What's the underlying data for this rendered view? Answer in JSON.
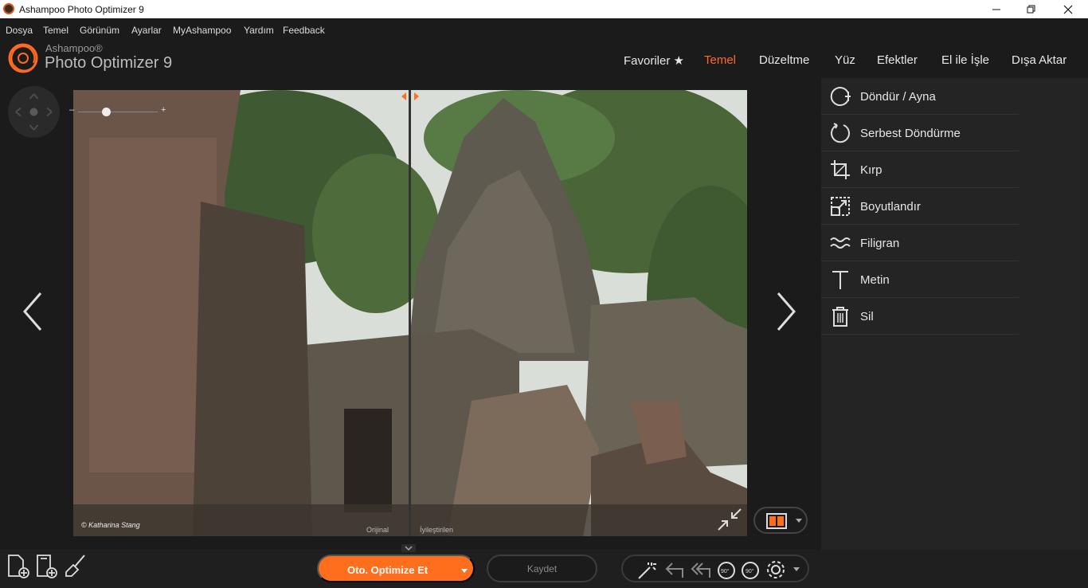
{
  "window": {
    "title": "Ashampoo Photo Optimizer 9"
  },
  "menu": [
    "Dosya",
    "Temel",
    "Görünüm",
    "Ayarlar",
    "MyAshampoo",
    "Yardım",
    "Feedback"
  ],
  "brand": {
    "small": "Ashampoo®",
    "big": "Photo Optimizer 9"
  },
  "nav": {
    "items": [
      "Favoriler ★",
      "Temel",
      "Düzeltme",
      "Yüz",
      "Efektler",
      "El ile İşle",
      "Dışa Aktar"
    ],
    "active": "Temel"
  },
  "viewer": {
    "credit": "© Katharina Stang",
    "label_left": "Orijinal",
    "label_right": "İyileştirilen"
  },
  "tools": [
    "Döndür / Ayna",
    "Serbest Döndürme",
    "Kırp",
    "Boyutlandır",
    "Filigran",
    "Metin",
    "Sil"
  ],
  "bottom": {
    "optimize": "Oto. Optimize Et",
    "save": "Kaydet"
  },
  "colors": {
    "accent": "#ff6e1c",
    "panel": "#242425",
    "background": "#1b1b1c"
  }
}
